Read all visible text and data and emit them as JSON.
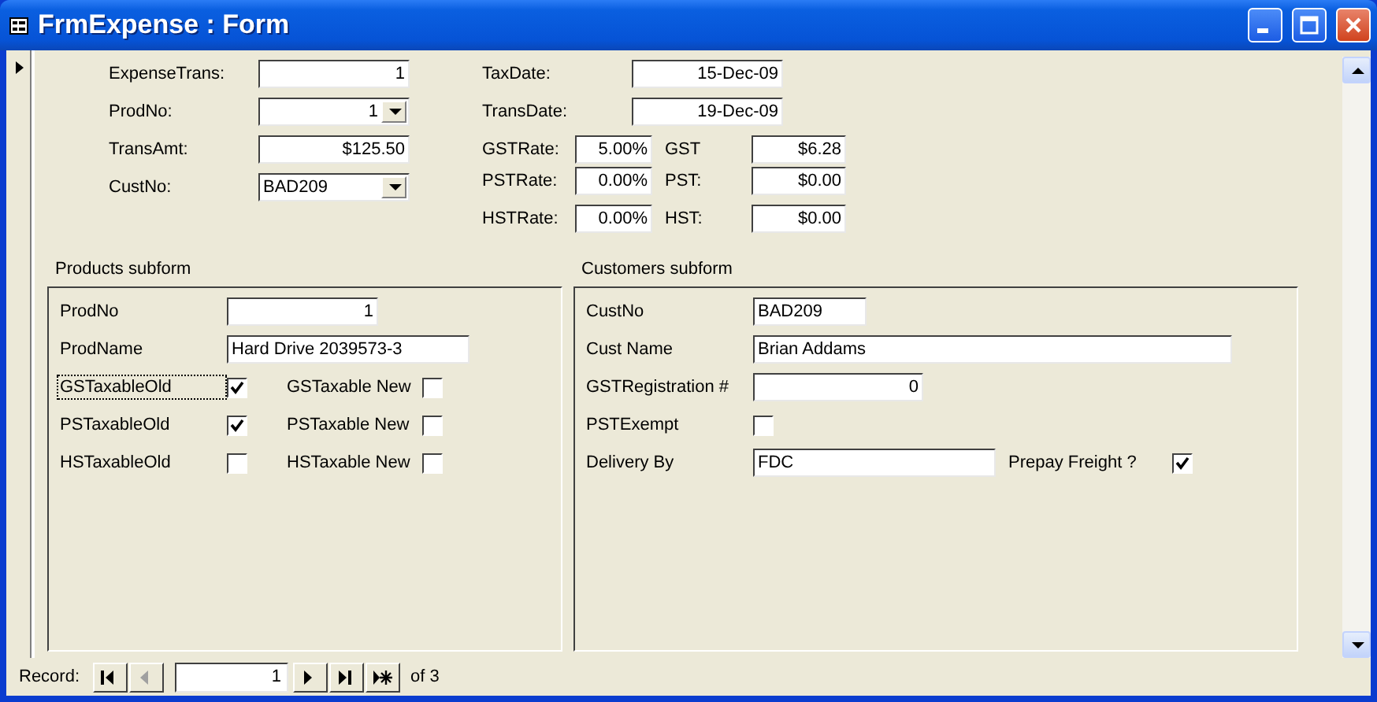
{
  "window": {
    "title": "FrmExpense : Form"
  },
  "main_fields": [
    {
      "label": "ExpenseTrans:",
      "value": "1",
      "right_aligned": true,
      "dropdown": false
    },
    {
      "label": "ProdNo:",
      "value": "1",
      "right_aligned": true,
      "dropdown": true
    },
    {
      "label": "TransAmt:",
      "value": "$125.50",
      "right_aligned": true,
      "dropdown": false
    },
    {
      "label": "CustNo:",
      "value": "BAD209",
      "right_aligned": false,
      "dropdown": true
    }
  ],
  "dates": [
    {
      "label": "TaxDate:",
      "value": "15-Dec-09"
    },
    {
      "label": "TransDate:",
      "value": "19-Dec-09"
    }
  ],
  "taxes": [
    {
      "rate_label": "GSTRate:",
      "rate": "5.00%",
      "tax_label": "GST",
      "tax": "$6.28"
    },
    {
      "rate_label": "PSTRate:",
      "rate": "0.00%",
      "tax_label": "PST:",
      "tax": "$0.00"
    },
    {
      "rate_label": "HSTRate:",
      "rate": "0.00%",
      "tax_label": "HST:",
      "tax": "$0.00"
    }
  ],
  "products_subform": {
    "title": "Products subform",
    "fields": [
      {
        "label": "ProdNo",
        "value": "1",
        "right_aligned": true
      },
      {
        "label": "ProdName",
        "value": "Hard Drive 2039573-3",
        "right_aligned": false
      }
    ],
    "flags": [
      {
        "old_label": "GSTaxableOld",
        "old_checked": true,
        "focused": true,
        "new_label": "GSTaxable New",
        "new_checked": false
      },
      {
        "old_label": "PSTaxableOld",
        "old_checked": true,
        "focused": false,
        "new_label": "PSTaxable New",
        "new_checked": false
      },
      {
        "old_label": "HSTaxableOld",
        "old_checked": false,
        "focused": false,
        "new_label": "HSTaxable New",
        "new_checked": false
      }
    ]
  },
  "customers_subform": {
    "title": "Customers subform",
    "rows": [
      {
        "kind": "text",
        "label": "CustNo",
        "value": "BAD209",
        "right_aligned": false
      },
      {
        "kind": "text",
        "label": "Cust Name",
        "value": "Brian Addams",
        "right_aligned": false
      },
      {
        "kind": "text",
        "label": "GSTRegistration #",
        "value": "0",
        "right_aligned": true
      },
      {
        "kind": "check",
        "label": "PSTExempt",
        "checked": false
      },
      {
        "kind": "text_check",
        "label": "Delivery By",
        "value": "FDC",
        "right_aligned": false,
        "check_label": "Prepay Freight ?",
        "checked": true
      }
    ]
  },
  "navigation": {
    "label": "Record:",
    "current": "1",
    "total": "of 3",
    "buttons": [
      {
        "kind": "first",
        "disabled": false
      },
      {
        "kind": "prev",
        "disabled": true
      }
    ],
    "after_buttons": [
      {
        "kind": "next",
        "disabled": false
      },
      {
        "kind": "last",
        "disabled": false
      },
      {
        "kind": "new",
        "disabled": false
      }
    ]
  }
}
